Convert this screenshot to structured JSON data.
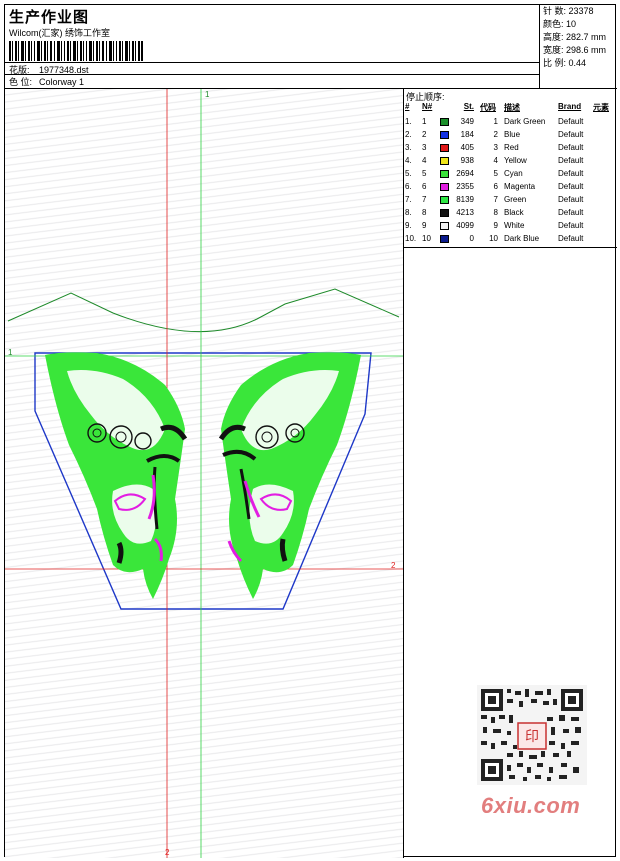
{
  "header": {
    "title": "生产作业图",
    "subtitle": "Wilcom(汇家) 绣饰工作室",
    "pattern_label": "花版:",
    "pattern_value": "1977348.dst",
    "colorway_label": "色 位:",
    "colorway_value": "Colorway 1"
  },
  "stats": {
    "stitches": "针 数: 23378",
    "colors": "颜色: 10",
    "height": "高度: 282.7 mm",
    "width": "宽度: 298.6 mm",
    "scale": "比 例: 0.44"
  },
  "canvas": {
    "guide_h1": "1",
    "guide_v1": "1",
    "guide_h2": "2",
    "guide_v2": "2"
  },
  "legend": {
    "stop_sequence": "停止顺序:",
    "columns": [
      "#",
      "N#",
      "St.",
      "代码",
      "描述",
      "Brand",
      "元素"
    ],
    "rows": [
      {
        "idx": "1.",
        "n": "1",
        "color": "#1a8f2a",
        "st": "349",
        "code": "1",
        "desc": "Dark Green",
        "brand": "Default"
      },
      {
        "idx": "2.",
        "n": "2",
        "color": "#1432e6",
        "st": "184",
        "code": "2",
        "desc": "Blue",
        "brand": "Default"
      },
      {
        "idx": "3.",
        "n": "3",
        "color": "#e01818",
        "st": "405",
        "code": "3",
        "desc": "Red",
        "brand": "Default"
      },
      {
        "idx": "4.",
        "n": "4",
        "color": "#f0e61a",
        "st": "938",
        "code": "4",
        "desc": "Yellow",
        "brand": "Default"
      },
      {
        "idx": "5.",
        "n": "5",
        "color": "#3ae03a",
        "st": "2694",
        "code": "5",
        "desc": "Cyan",
        "brand": "Default"
      },
      {
        "idx": "6.",
        "n": "6",
        "color": "#e21ee2",
        "st": "2355",
        "code": "6",
        "desc": "Magenta",
        "brand": "Default"
      },
      {
        "idx": "7.",
        "n": "7",
        "color": "#2ee845",
        "st": "8139",
        "code": "7",
        "desc": "Green",
        "brand": "Default"
      },
      {
        "idx": "8.",
        "n": "8",
        "color": "#111111",
        "st": "4213",
        "code": "8",
        "desc": "Black",
        "brand": "Default"
      },
      {
        "idx": "9.",
        "n": "9",
        "color": "#f2f2f2",
        "st": "4099",
        "code": "9",
        "desc": "White",
        "brand": "Default"
      },
      {
        "idx": "10.",
        "n": "10",
        "color": "#0a1a8c",
        "st": "0",
        "code": "10",
        "desc": "Dark Blue",
        "brand": "Default"
      }
    ]
  },
  "watermark": {
    "text": "6xiu.com",
    "seal": "印"
  }
}
